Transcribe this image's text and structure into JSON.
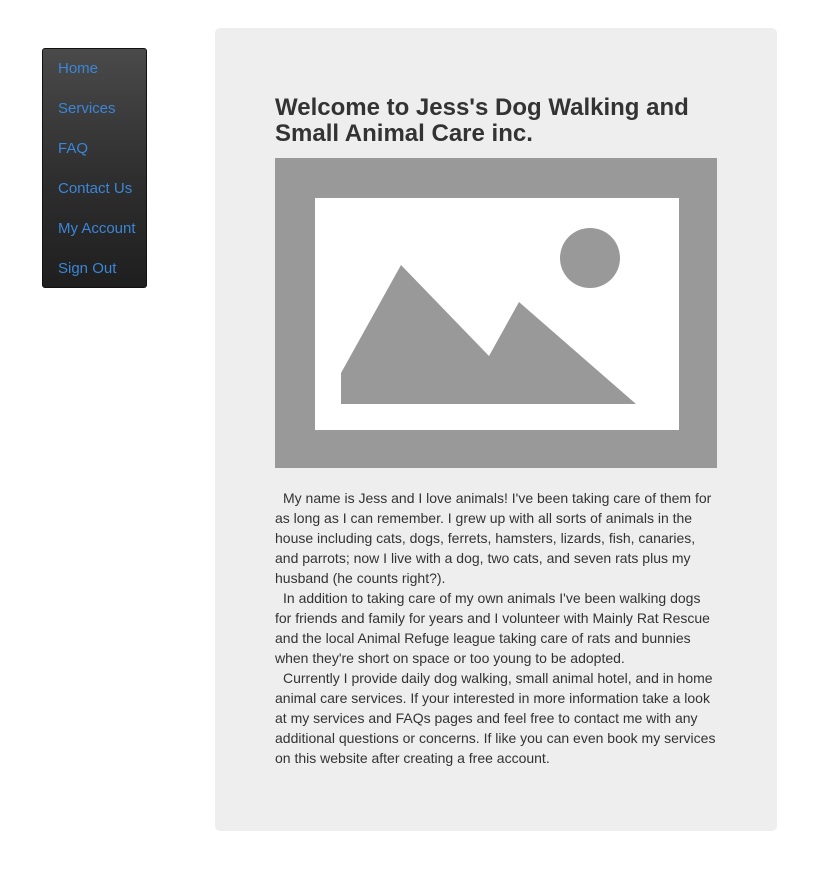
{
  "nav": {
    "items": [
      {
        "label": "Home"
      },
      {
        "label": "Services"
      },
      {
        "label": "FAQ"
      },
      {
        "label": "Contact Us"
      },
      {
        "label": "My Account"
      },
      {
        "label": "Sign Out"
      }
    ]
  },
  "main": {
    "title": "Welcome to Jess's Dog Walking and Small Animal Care inc.",
    "hero_image_icon": "image-placeholder-icon",
    "paragraphs": [
      "My name is Jess and I love animals! I've been taking care of them for as long as I can remember. I grew up with all sorts of animals in the house including cats, dogs, ferrets, hamsters, lizards, fish, canaries, and parrots; now I live with a dog, two cats, and seven rats plus my husband (he counts right?).",
      "In addition to taking care of my own animals I've been walking dogs for friends and family for years and I volunteer with Mainly Rat Rescue and the local Animal Refuge league taking care of rats and bunnies when they're short on space or too young to be adopted.",
      "Currently I provide daily dog walking, small animal hotel, and in home animal care services. If your interested in more information take a look at my services and FAQs pages and feel free to contact me with any additional questions or concerns. If like you can even book my services on this website after creating a free account."
    ]
  },
  "colors": {
    "nav_link": "#3a86d8",
    "panel_background": "#eeeeee",
    "text": "#333333",
    "placeholder_gray": "#999999"
  }
}
